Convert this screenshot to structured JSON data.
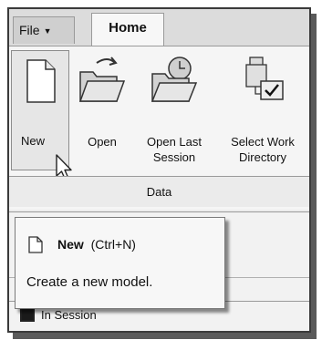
{
  "tabs": {
    "file_label": "File",
    "home_label": "Home"
  },
  "ribbon": {
    "commands": [
      {
        "label": "New",
        "icon": "new-document-icon"
      },
      {
        "label": "Open",
        "icon": "open-folder-icon"
      },
      {
        "label_line1": "Open Last",
        "label_line2": "Session",
        "icon": "open-last-session-icon"
      },
      {
        "label_line1": "Select Work",
        "label_line2": "Directory",
        "icon": "select-working-directory-icon"
      }
    ],
    "group_label": "Data"
  },
  "tooltip": {
    "title": "New",
    "shortcut": "(Ctrl+N)",
    "description": "Create a new model."
  },
  "status": {
    "label": "In Session"
  },
  "colors": {
    "frame_border": "#3a3a3a",
    "ribbon_bg": "#f5f5f5",
    "tab_strip_bg": "#dcdcdc"
  }
}
